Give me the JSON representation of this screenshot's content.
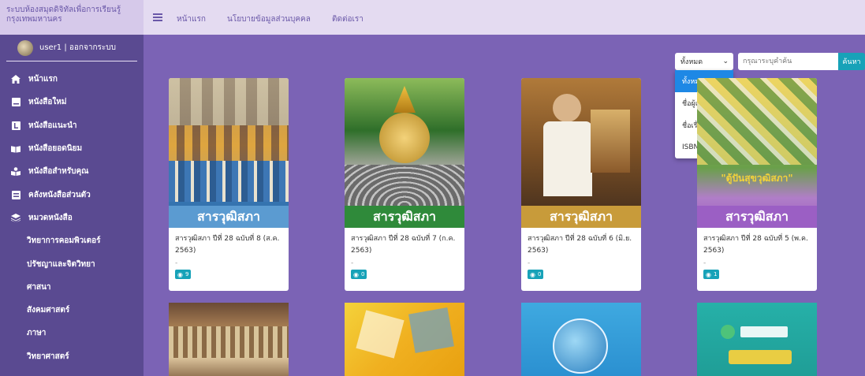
{
  "brand": {
    "line1": "ระบบห้องสมุดดิจิทัลเพื่อการเรียนรู้",
    "line2": "กรุงเทพมหานคร"
  },
  "topnav": [
    "หน้าแรก",
    "นโยบายข้อมูลส่วนบุคคล",
    "ติดต่อเรา"
  ],
  "user": {
    "label": "user1 | ออกจากระบบ"
  },
  "sidebar": {
    "items": [
      {
        "icon": "home-icon",
        "label": "หน้าแรก"
      },
      {
        "icon": "book-icon",
        "label": "หนังสือใหม่"
      },
      {
        "icon": "recommend-icon",
        "label": "หนังสือแนะนำ"
      },
      {
        "icon": "open-book-icon",
        "label": "หนังสือยอดนิยม"
      },
      {
        "icon": "user-book-icon",
        "label": "หนังสือสำหรับคุณ"
      },
      {
        "icon": "shelf-icon",
        "label": "คลังหนังสือส่วนตัว"
      },
      {
        "icon": "layers-icon",
        "label": "หมวดหนังสือ"
      }
    ],
    "categories": [
      "วิทยาการคอมพิวเตอร์",
      "ปรัชญาและจิตวิทยา",
      "ศาสนา",
      "สังคมศาสตร์",
      "ภาษา",
      "วิทยาศาสตร์"
    ]
  },
  "search": {
    "selected": "ทั้งหมด",
    "placeholder": "กรุณาระบุคำค้น",
    "button": "ค้นหา",
    "options": [
      "ทั้งหมด",
      "ชื่อผู้แต่ง",
      "ชื่อเรื่อง",
      "ISBN/ISSN"
    ]
  },
  "books": [
    {
      "title": "สารวุฒิสภา ปีที่ 28 ฉบับที่ 8 (ส.ค. 2563)",
      "author": "-",
      "views": "9",
      "masthead": "สารวุฒิสภา"
    },
    {
      "title": "สารวุฒิสภา ปีที่ 28 ฉบับที่ 7 (ก.ค. 2563)",
      "author": "-",
      "views": "0",
      "masthead": "สารวุฒิสภา"
    },
    {
      "title": "สารวุฒิสภา ปีที่ 28 ฉบับที่ 6 (มิ.ย. 2563)",
      "author": "-",
      "views": "0",
      "masthead": "สารวุฒิสภา"
    },
    {
      "title": "สารวุฒิสภา ปีที่ 28 ฉบับที่ 5 (พ.ค. 2563)",
      "author": "-",
      "views": "1",
      "masthead": "สารวุฒิสภา"
    }
  ],
  "book4_cover_text": "\"ตู้ปันสุขวุฒิสภา\"",
  "colors": {
    "accent": "#17a2b8",
    "sidebar": "#5a4a91",
    "content": "#7b63b5",
    "topbar": "#e4dbf1"
  }
}
